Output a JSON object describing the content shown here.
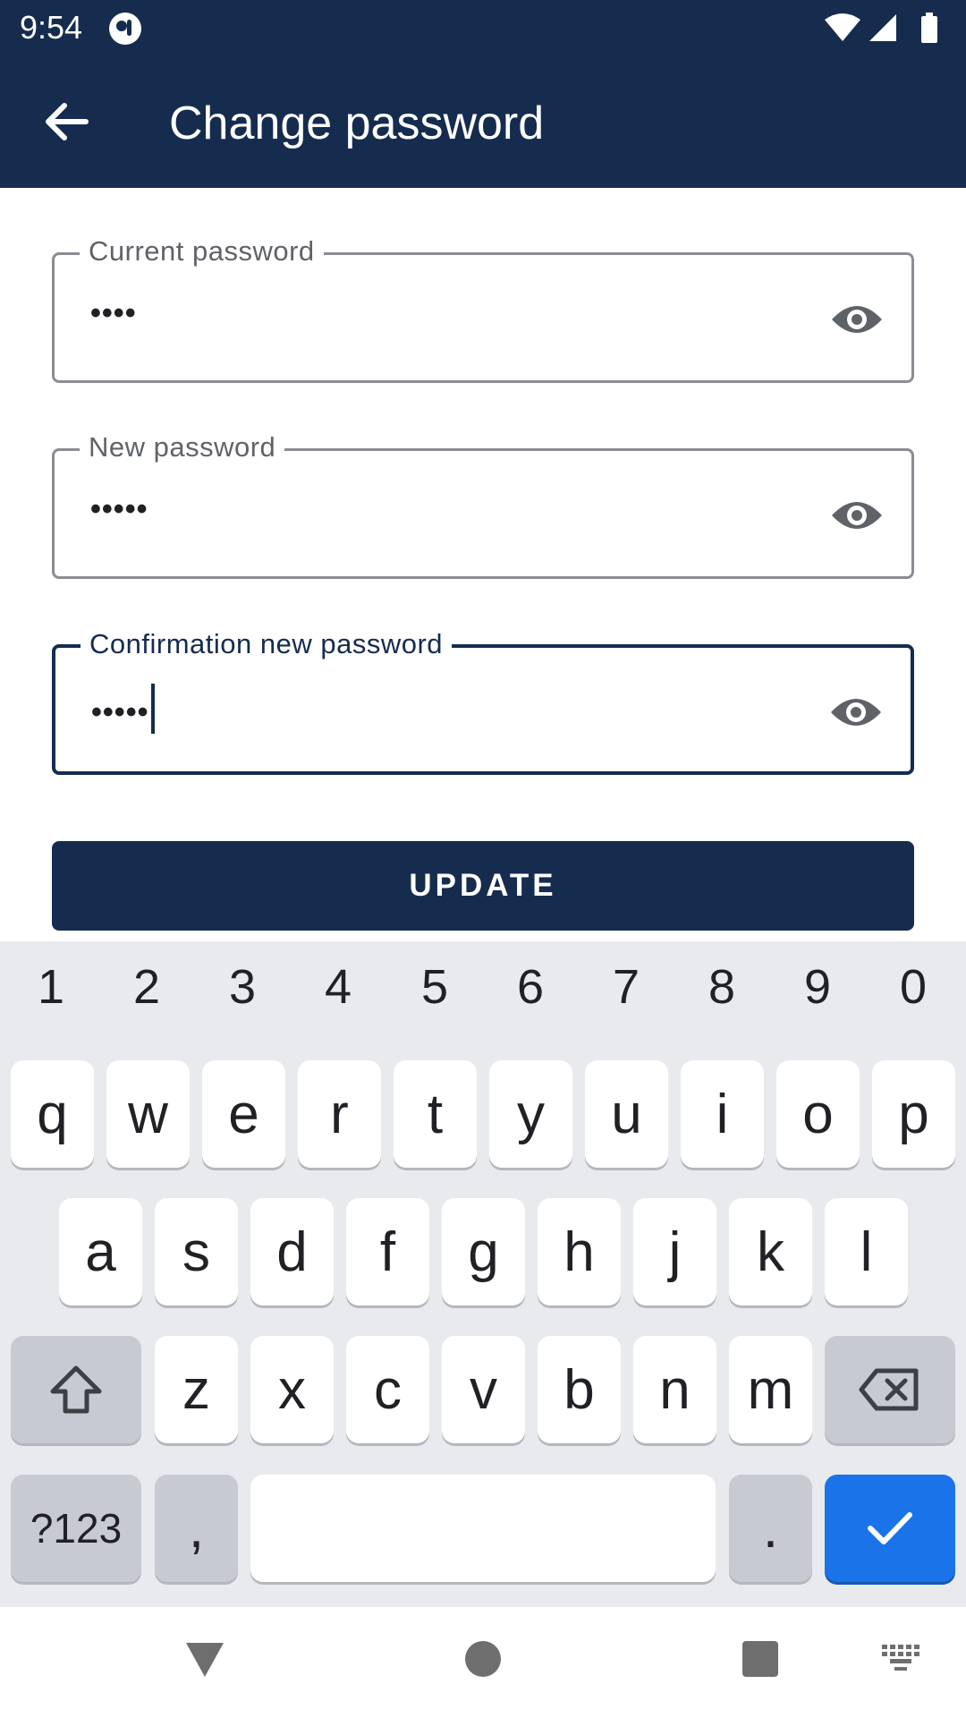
{
  "status_bar": {
    "time": "9:54"
  },
  "app_bar": {
    "title": "Change password",
    "back_icon": "arrow-back-icon"
  },
  "form": {
    "current_password": {
      "label": "Current password",
      "value": "••••",
      "toggle_icon": "eye-icon"
    },
    "new_password": {
      "label": "New password",
      "value": "•••••",
      "toggle_icon": "eye-icon"
    },
    "confirm_password": {
      "label": "Confirmation new password",
      "value": "•••••",
      "toggle_icon": "eye-icon"
    },
    "update_label": "UPDATE"
  },
  "keyboard": {
    "numbers": [
      "1",
      "2",
      "3",
      "4",
      "5",
      "6",
      "7",
      "8",
      "9",
      "0"
    ],
    "row1": [
      "q",
      "w",
      "e",
      "r",
      "t",
      "y",
      "u",
      "i",
      "o",
      "p"
    ],
    "row2": [
      "a",
      "s",
      "d",
      "f",
      "g",
      "h",
      "j",
      "k",
      "l"
    ],
    "row3": [
      "z",
      "x",
      "c",
      "v",
      "b",
      "n",
      "m"
    ],
    "symbols_label": "?123",
    "comma_label": ",",
    "period_label": "."
  },
  "colors": {
    "primary": "#152c4f",
    "enter_key": "#1a73e8",
    "keyboard_bg": "#e8eaed"
  }
}
